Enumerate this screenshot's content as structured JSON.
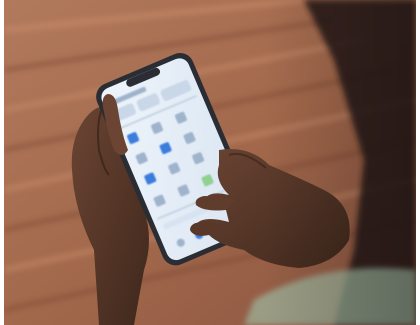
{
  "photo": {
    "subject": "hands-holding-smartphone",
    "icons": [
      "phone",
      "app-tile-icons"
    ]
  },
  "colors": {
    "deck": "#a66a4e",
    "deck_dark": "#6e3f2b",
    "deck_light": "#c98c6c",
    "skin": "#5b3a2a",
    "skin_dark": "#3d2619",
    "skin_light": "#7a5140",
    "phone_frame": "#2a2d33",
    "screen": "#e6eef7",
    "tile": "#d7e3f1",
    "accent": "#3b7ddd"
  }
}
